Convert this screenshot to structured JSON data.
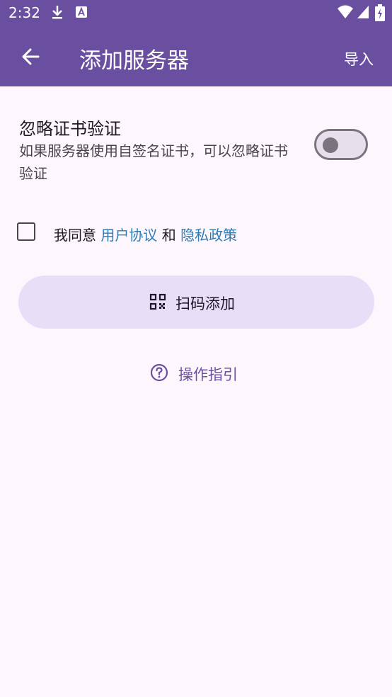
{
  "status_bar": {
    "time": "2:32"
  },
  "app_bar": {
    "title": "添加服务器",
    "import_label": "导入"
  },
  "ignore_cert": {
    "title": "忽略证书验证",
    "description": "如果服务器使用自签名证书，可以忽略证书验证",
    "enabled": false
  },
  "agreement": {
    "prefix": "我同意",
    "user_agreement": "用户协议",
    "and": "和",
    "privacy_policy": "隐私政策",
    "checked": false
  },
  "scan_button": {
    "label": "扫码添加"
  },
  "guide": {
    "label": "操作指引"
  },
  "colors": {
    "primary": "#6a4fa1",
    "button_bg": "#e8def8",
    "link": "#2e7bb4"
  }
}
